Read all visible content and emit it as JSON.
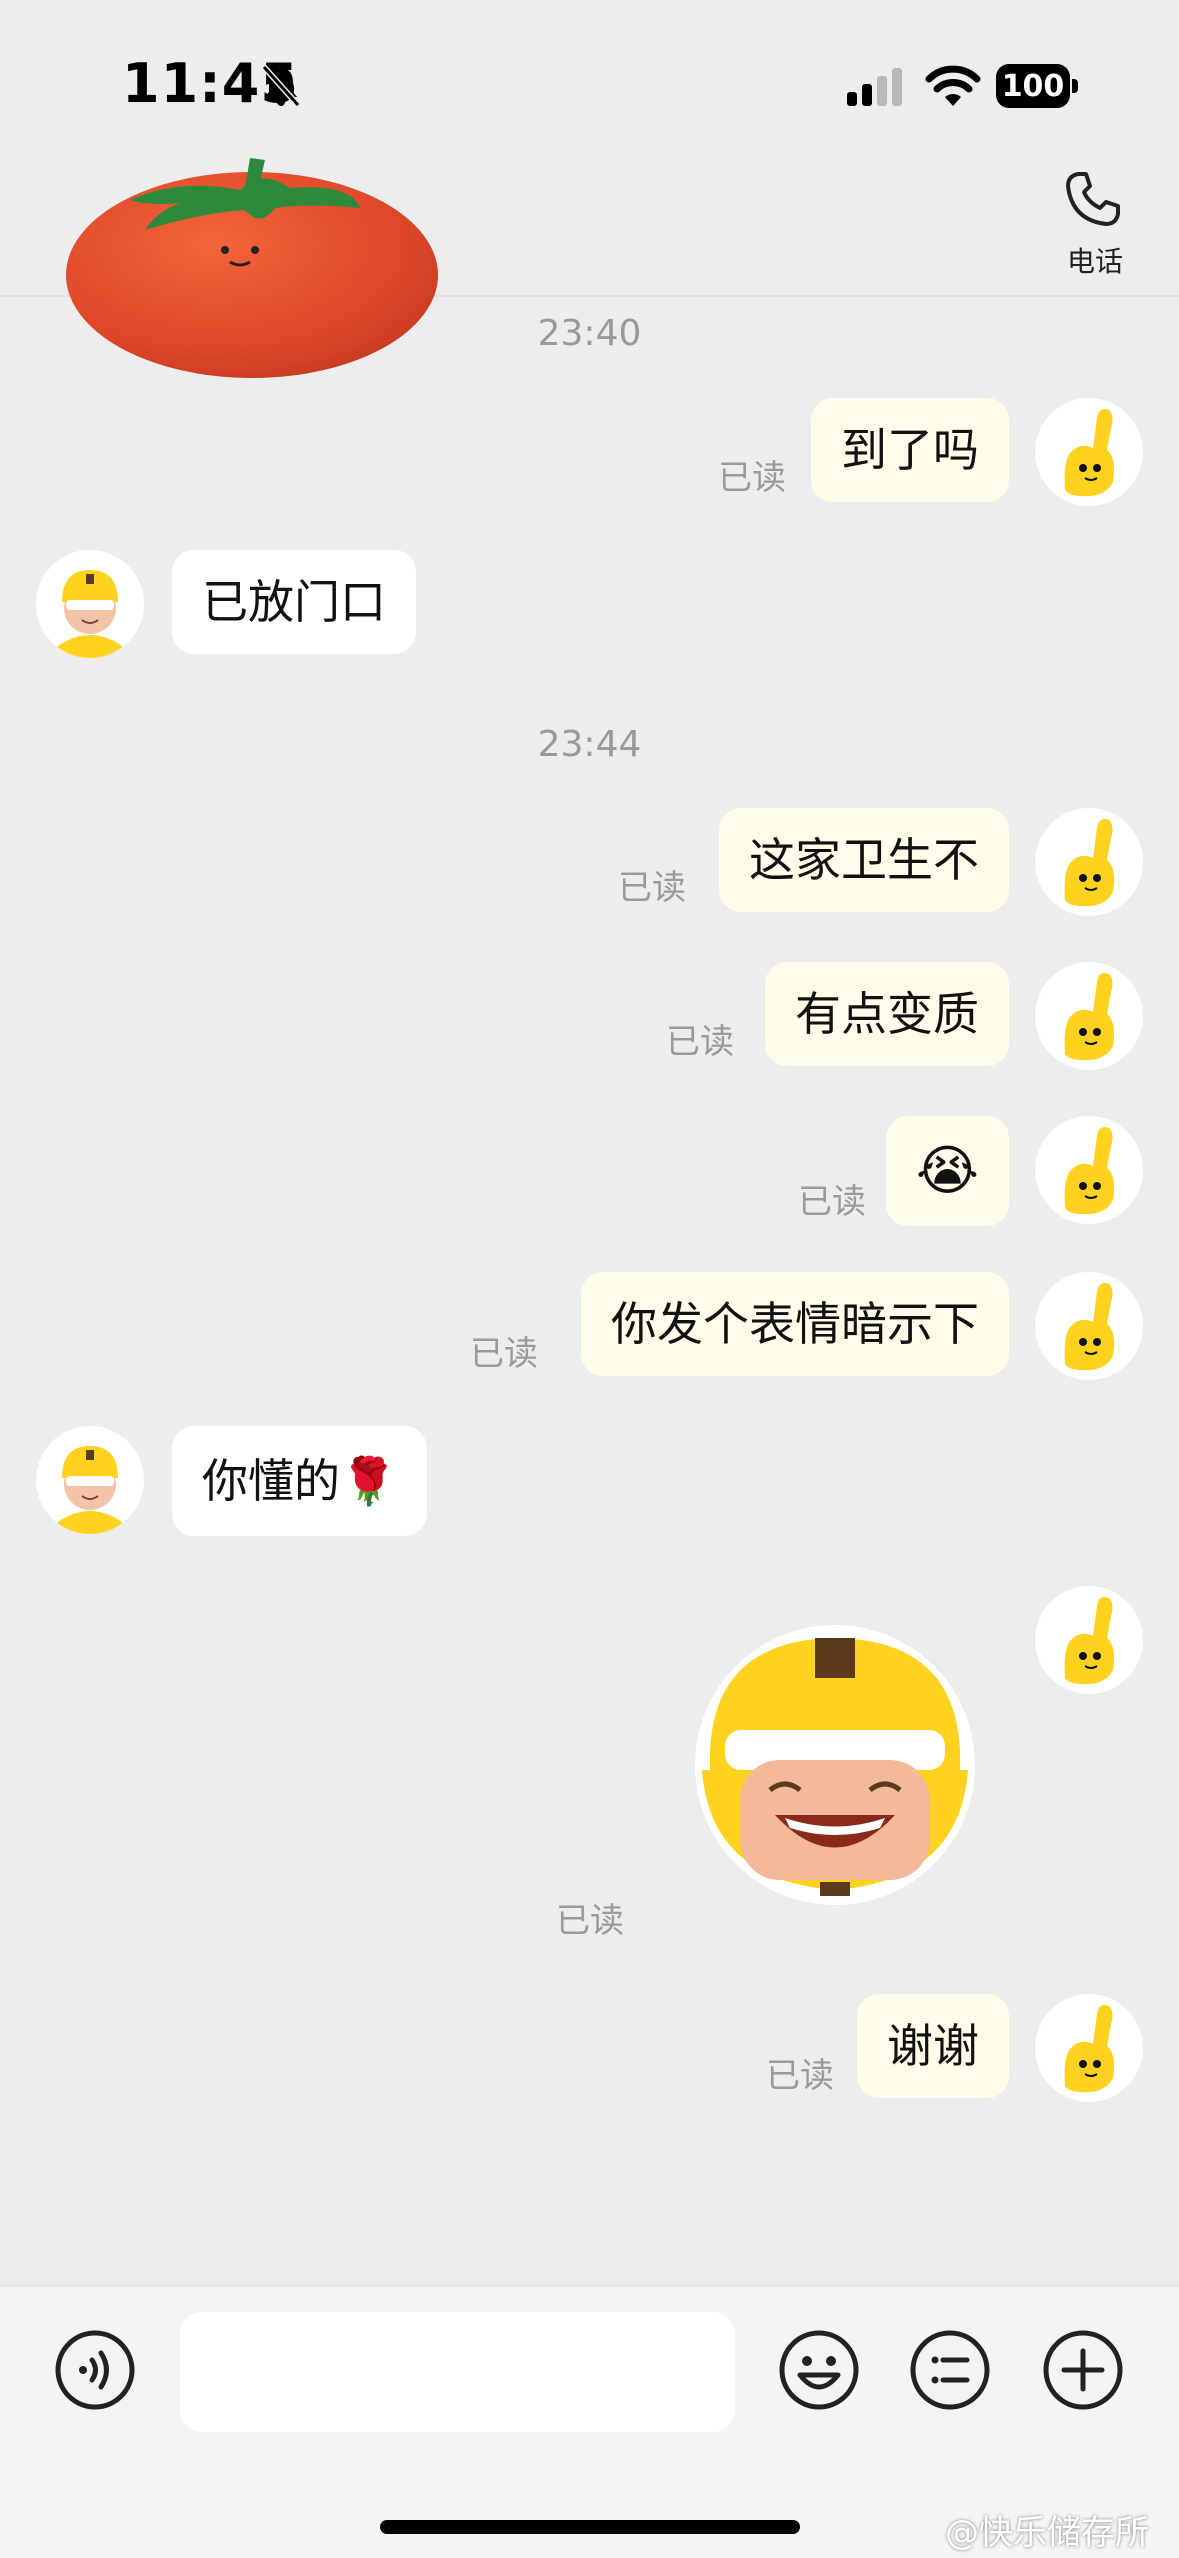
{
  "status_bar": {
    "time": "11:45",
    "battery": "100"
  },
  "header": {
    "call_label": "电话"
  },
  "messages": {
    "ts1": "23:40",
    "m1": {
      "text": "到了吗",
      "read": "已读"
    },
    "m2": {
      "text": "已放门口"
    },
    "ts2": "23:44",
    "m3": {
      "text": "这家卫生不",
      "read": "已读"
    },
    "m4": {
      "text": "有点变质",
      "read": "已读"
    },
    "m5": {
      "text": "😭",
      "read": "已读"
    },
    "m6": {
      "text": "你发个表情暗示下",
      "read": "已读"
    },
    "m7": {
      "text": "你懂的🌹"
    },
    "m8": {
      "read": "已读"
    },
    "m9": {
      "text": "谢谢",
      "read": "已读"
    }
  },
  "input": {
    "placeholder": ""
  },
  "watermark": "@快乐储存所",
  "colors": {
    "background": "#ededed",
    "my_bubble": "#fffde9",
    "their_bubble": "#ffffff",
    "rider_yellow": "#ffd21f"
  },
  "icons": [
    "muted-bell-icon",
    "cellular-signal-icon",
    "wifi-icon",
    "battery-icon",
    "phone-icon",
    "voice-icon",
    "emoji-icon",
    "list-icon",
    "plus-icon"
  ]
}
